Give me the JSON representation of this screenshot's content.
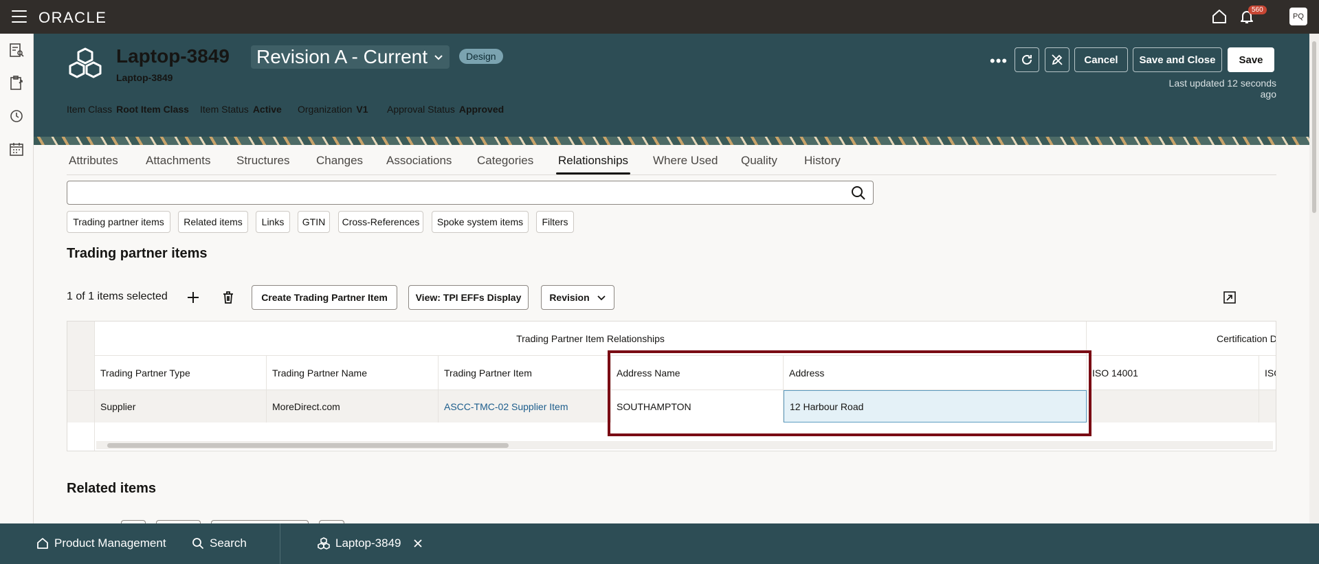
{
  "topbar": {
    "logo": "ORACLE",
    "notification_count": "560",
    "avatar_initials": "PQ"
  },
  "header": {
    "title": "Laptop-3849",
    "subtitle": "Laptop-3849",
    "revision": "Revision A - Current",
    "status_badge": "Design",
    "item_class_label": "Item Class",
    "item_class_value": "Root Item Class",
    "item_status_label": "Item Status",
    "item_status_value": "Active",
    "organization_label": "Organization",
    "organization_value": "V1",
    "approval_status_label": "Approval Status",
    "approval_status_value": "Approved",
    "cancel_label": "Cancel",
    "save_close_label": "Save and Close",
    "save_label": "Save",
    "last_updated": "Last updated 12 seconds ago"
  },
  "tabs": [
    {
      "label": "Attributes"
    },
    {
      "label": "Attachments"
    },
    {
      "label": "Structures"
    },
    {
      "label": "Changes"
    },
    {
      "label": "Associations"
    },
    {
      "label": "Categories"
    },
    {
      "label": "Relationships"
    },
    {
      "label": "Where Used"
    },
    {
      "label": "Quality"
    },
    {
      "label": "History"
    }
  ],
  "active_tab": "Relationships",
  "search": {
    "placeholder": ""
  },
  "chips": [
    {
      "label": "Trading partner items"
    },
    {
      "label": "Related items"
    },
    {
      "label": "Links"
    },
    {
      "label": "GTIN"
    },
    {
      "label": "Cross-References"
    },
    {
      "label": "Spoke system items"
    },
    {
      "label": "Filters"
    }
  ],
  "section1": {
    "title": "Trading partner items",
    "selection_text": "1 of 1 items selected",
    "create_button": "Create Trading Partner Item",
    "view_button": "View: TPI EFFs Display",
    "revision_button": "Revision"
  },
  "table": {
    "group_header": "Trading Partner Item Relationships",
    "group_header_2": "Certification D",
    "columns": [
      "Trading Partner Type",
      "Trading Partner Name",
      "Trading Partner Item",
      "Address Name",
      "Address",
      "ISO 14001",
      "ISO"
    ],
    "rows": [
      {
        "type": "Supplier",
        "name": "MoreDirect.com",
        "item": "ASCC-TMC-02 Supplier Item",
        "address_name": "SOUTHAMPTON",
        "address": "12 Harbour Road",
        "iso14001": "",
        "iso": ""
      }
    ]
  },
  "section2": {
    "title": "Related items"
  },
  "bottombar": {
    "product_management": "Product Management",
    "search": "Search",
    "open_tab": "Laptop-3849"
  }
}
